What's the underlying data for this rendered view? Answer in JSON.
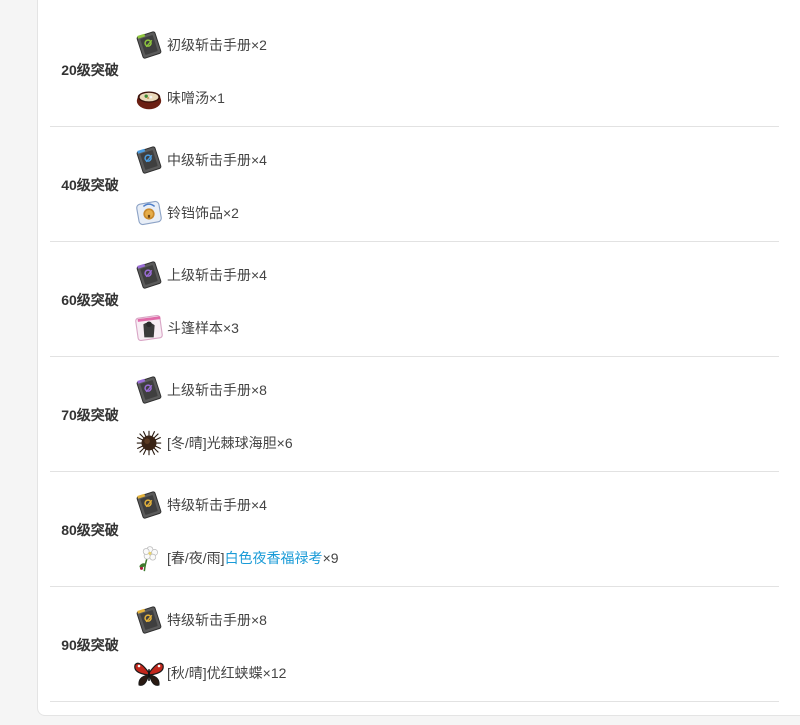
{
  "rows": [
    {
      "label": "20级突破",
      "item1": {
        "icon": "beginner-blade-manual-icon",
        "text": "初级斩击手册×2"
      },
      "item2": {
        "icon": "miso-soup-icon",
        "text": "味噌汤×1"
      }
    },
    {
      "label": "40级突破",
      "item1": {
        "icon": "intermediate-blade-manual-icon",
        "text": "中级斩击手册×4"
      },
      "item2": {
        "icon": "bell-ornament-icon",
        "text": "铃铛饰品×2"
      }
    },
    {
      "label": "60级突破",
      "item1": {
        "icon": "advanced-blade-manual-icon",
        "text": "上级斩击手册×4"
      },
      "item2": {
        "icon": "cloak-sample-icon",
        "text": "斗篷样本×3"
      }
    },
    {
      "label": "70级突破",
      "item1": {
        "icon": "advanced-blade-manual-icon",
        "text": "上级斩击手册×8"
      },
      "item2": {
        "icon": "sea-urchin-icon",
        "text": "[冬/晴]光棘球海胆×6"
      }
    },
    {
      "label": "80级突破",
      "item1": {
        "icon": "special-blade-manual-icon",
        "text": "特级斩击手册×4"
      },
      "item2": {
        "icon": "white-flower-icon",
        "prefix": "[春/夜/雨]",
        "link": "白色夜香福禄考",
        "suffix": "×9"
      }
    },
    {
      "label": "90级突破",
      "item1": {
        "icon": "special-blade-manual-icon",
        "text": "特级斩击手册×8"
      },
      "item2": {
        "icon": "butterfly-icon",
        "text": "[秋/晴]优红蛱蝶×12"
      }
    }
  ],
  "colors": {
    "link": "#1a9bd7",
    "text": "#444444",
    "label": "#333333",
    "divider": "#e2e2e2"
  }
}
